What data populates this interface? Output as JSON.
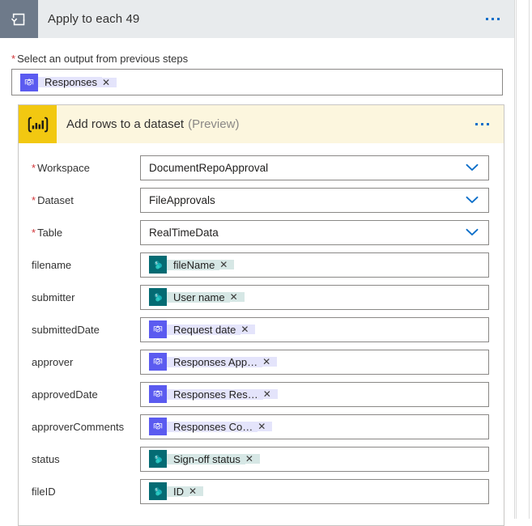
{
  "apply_card": {
    "icon": "loop-icon",
    "title": "Apply to each 49",
    "menu_icon": "more-options-icon",
    "required_label": "Select an output from previous steps",
    "required_marker": "*",
    "output_token": {
      "connector": "approvals",
      "icon": "approvals-icon",
      "label": "Responses",
      "remove": "✕"
    }
  },
  "pbi_card": {
    "icon": "power-bi-icon",
    "title": "Add rows to a dataset",
    "preview": "(Preview)",
    "menu_icon": "more-options-icon",
    "dropdown_fields": [
      {
        "label": "Workspace",
        "required": "*",
        "value": "DocumentRepoApproval",
        "chevron": "chevron-down-icon"
      },
      {
        "label": "Dataset",
        "required": "*",
        "value": "FileApprovals",
        "chevron": "chevron-down-icon"
      },
      {
        "label": "Table",
        "required": "*",
        "value": "RealTimeData",
        "chevron": "chevron-down-icon"
      }
    ],
    "token_fields": [
      {
        "label": "filename",
        "connector": "sharepoint",
        "icon": "sharepoint-icon",
        "token": "fileName",
        "remove": "✕"
      },
      {
        "label": "submitter",
        "connector": "sharepoint",
        "icon": "sharepoint-icon",
        "token": "User name",
        "remove": "✕"
      },
      {
        "label": "submittedDate",
        "connector": "approvals",
        "icon": "approvals-icon",
        "token": "Request date",
        "remove": "✕"
      },
      {
        "label": "approver",
        "connector": "approvals",
        "icon": "approvals-icon",
        "token": "Responses App…",
        "remove": "✕"
      },
      {
        "label": "approvedDate",
        "connector": "approvals",
        "icon": "approvals-icon",
        "token": "Responses Res…",
        "remove": "✕"
      },
      {
        "label": "approverComments",
        "connector": "approvals",
        "icon": "approvals-icon",
        "token": "Responses Co…",
        "remove": "✕"
      },
      {
        "label": "status",
        "connector": "sharepoint",
        "icon": "sharepoint-icon",
        "token": "Sign-off status",
        "remove": "✕"
      },
      {
        "label": "fileID",
        "connector": "sharepoint",
        "icon": "sharepoint-icon",
        "token": "ID",
        "remove": "✕"
      }
    ]
  },
  "colors": {
    "apply_header_bg": "#e8ebed",
    "apply_icon_bg": "#6e7a8a",
    "powerbi_yellow": "#f2c811",
    "powerbi_header_bg": "#fcf6de",
    "sharepoint_teal": "#046b73",
    "sharepoint_token_bg": "#d6e7e5",
    "approvals_purple": "#5b5bf0",
    "approvals_token_bg": "#e4e4fb",
    "accent_blue": "#0b6ec9",
    "required_red": "#d13438",
    "border_gray": "#8a8886"
  }
}
